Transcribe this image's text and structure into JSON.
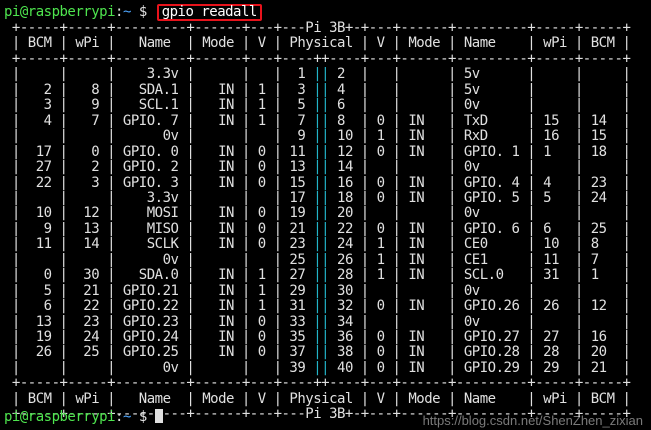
{
  "prompt": {
    "user_host": "pi@raspberrypi",
    "separator": ":",
    "path": "~",
    "dollar": " $ "
  },
  "command": "gpio readall",
  "table": {
    "rows": [
      " +-----+-----+---------+------+---+---Pi 3B+-+---+------+---------+-----+-----+",
      " | BCM | wPi |   Name  | Mode | V | Physical | V | Mode | Name    | wPi | BCM |",
      " +-----+-----+---------+------+---+----++----+---+------+---------+-----+-----+",
      " |     |     |    3.3v |      |   |  1 || 2  |   |      | 5v      |     |     |",
      " |   2 |   8 |   SDA.1 |   IN | 1 |  3 || 4  |   |      | 5v      |     |     |",
      " |   3 |   9 |   SCL.1 |   IN | 1 |  5 || 6  |   |      | 0v      |     |     |",
      " |   4 |   7 | GPIO. 7 |   IN | 1 |  7 || 8  | 0 | IN   | TxD     | 15  | 14  |",
      " |     |     |      0v |      |   |  9 || 10 | 1 | IN   | RxD     | 16  | 15  |",
      " |  17 |   0 | GPIO. 0 |   IN | 0 | 11 || 12 | 0 | IN   | GPIO. 1 | 1   | 18  |",
      " |  27 |   2 | GPIO. 2 |   IN | 0 | 13 || 14 |   |      | 0v      |     |     |",
      " |  22 |   3 | GPIO. 3 |   IN | 0 | 15 || 16 | 0 | IN   | GPIO. 4 | 4   | 23  |",
      " |     |     |    3.3v |      |   | 17 || 18 | 0 | IN   | GPIO. 5 | 5   | 24  |",
      " |  10 |  12 |    MOSI |   IN | 0 | 19 || 20 |   |      | 0v      |     |     |",
      " |   9 |  13 |    MISO |   IN | 0 | 21 || 22 | 0 | IN   | GPIO. 6 | 6   | 25  |",
      " |  11 |  14 |    SCLK |   IN | 0 | 23 || 24 | 1 | IN   | CE0     | 10  | 8   |",
      " |     |     |      0v |      |   | 25 || 26 | 1 | IN   | CE1     | 11  | 7   |",
      " |   0 |  30 |   SDA.0 |   IN | 1 | 27 || 28 | 1 | IN   | SCL.0   | 31  | 1   |",
      " |   5 |  21 | GPIO.21 |   IN | 1 | 29 || 30 |   |      | 0v      |     |     |",
      " |   6 |  22 | GPIO.22 |   IN | 1 | 31 || 32 | 0 | IN   | GPIO.26 | 26  | 12  |",
      " |  13 |  23 | GPIO.23 |   IN | 0 | 33 || 34 |   |      | 0v      |     |     |",
      " |  19 |  24 | GPIO.24 |   IN | 0 | 35 || 36 | 0 | IN   | GPIO.27 | 27  | 16  |",
      " |  26 |  25 | GPIO.25 |   IN | 0 | 37 || 38 | 0 | IN   | GPIO.28 | 28  | 20  |",
      " |     |     |      0v |      |   | 39 || 40 | 0 | IN   | GPIO.29 | 29  | 21  |",
      " +-----+-----+---------+------+---+----++----+---+------+---------+-----+-----+",
      " | BCM | wPi |   Name  | Mode | V | Physical | V | Mode | Name    | wPi | BCM |",
      " +-----+-----+---------+------+---+---Pi 3B+-+---+------+---------+-----+-----+"
    ]
  },
  "watermark": "https://blog.csdn.net/ShenZhen_zixian",
  "colors": {
    "background": "#000000",
    "text": "#e0e0e0",
    "prompt_user": "#4ee44e",
    "prompt_path": "#4ea6ff",
    "physical_separator": "#22b4c8",
    "highlight_box": "#e8131c"
  }
}
